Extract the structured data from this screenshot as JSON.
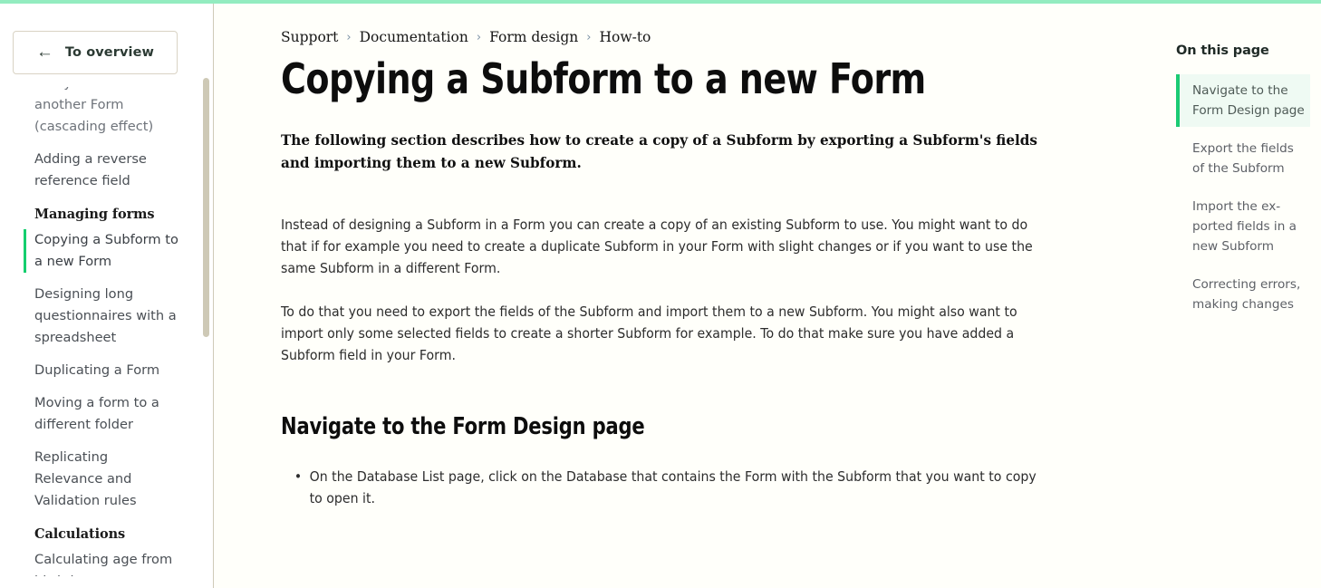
{
  "theme": {
    "accent_green": "#14ce6e",
    "top_bar_green": "#93ecc0",
    "toc_active_bg": "#effaf3",
    "page_bg": "#fffffa",
    "sidebar_bg": "#ffffff",
    "divider": "#cfcab8",
    "scrollbar_thumb": "#cec9b6"
  },
  "sidebar": {
    "overview_button": {
      "label": "To overview",
      "icon": "arrow-left-icon"
    },
    "entries": [
      {
        "type": "item",
        "label": "many fields of another Form (cascading effect)",
        "active": false,
        "clipped": true
      },
      {
        "type": "item",
        "label": "Adding a reverse reference field",
        "active": false,
        "clipped": false
      },
      {
        "type": "group",
        "label": "Managing forms"
      },
      {
        "type": "item",
        "label": "Copying a Subform to a new Form",
        "active": true,
        "clipped": false
      },
      {
        "type": "item",
        "label": "Designing long questionnaires with a spreadsheet",
        "active": false,
        "clipped": false
      },
      {
        "type": "item",
        "label": "Duplicating a Form",
        "active": false,
        "clipped": false
      },
      {
        "type": "item",
        "label": "Moving a form to a different folder",
        "active": false,
        "clipped": false
      },
      {
        "type": "item",
        "label": "Replicating Relevance and Validation rules",
        "active": false,
        "clipped": false
      },
      {
        "type": "group",
        "label": "Calculations"
      },
      {
        "type": "item",
        "label": "Calculating age from birthdate",
        "active": false,
        "clipped": false
      }
    ]
  },
  "breadcrumb": {
    "separator": "›",
    "items": [
      "Support",
      "Documentation",
      "Form design",
      "How-to"
    ]
  },
  "article": {
    "title": "Copying a Subform to a new Form",
    "lead": "The following section describes how to create a copy of a Subform by exporting a Subform's fields and importing them to a new Subform.",
    "paragraphs": [
      "Instead of designing a Subform in a Form you can create a copy of an existing Subform to use. You might want to do that if for example you need to create a duplicate Subform in your Form with slight changes or if you want to use the same Subform in a different Form.",
      "To do that you need to export the fields of the Subform and import them to a new Subform. You might also want to import only some selected fields to create a shorter Subform for example. To do that make sure you have added a Subform field in your Form."
    ],
    "section_heading": "Navigate to the Form Design page",
    "bullets": [
      "On the Database List page, click on the Database that contains the Form with the Subform that you want to copy to open it."
    ]
  },
  "toc": {
    "title": "On this page",
    "items": [
      {
        "label": "Navigate to the Form Design page",
        "active": true
      },
      {
        "label": "Export the fields of the Subform",
        "active": false
      },
      {
        "label": "Import the ex­ported fields in a new Subform",
        "active": false
      },
      {
        "label": "Correcting errors, making changes",
        "active": false
      }
    ]
  }
}
